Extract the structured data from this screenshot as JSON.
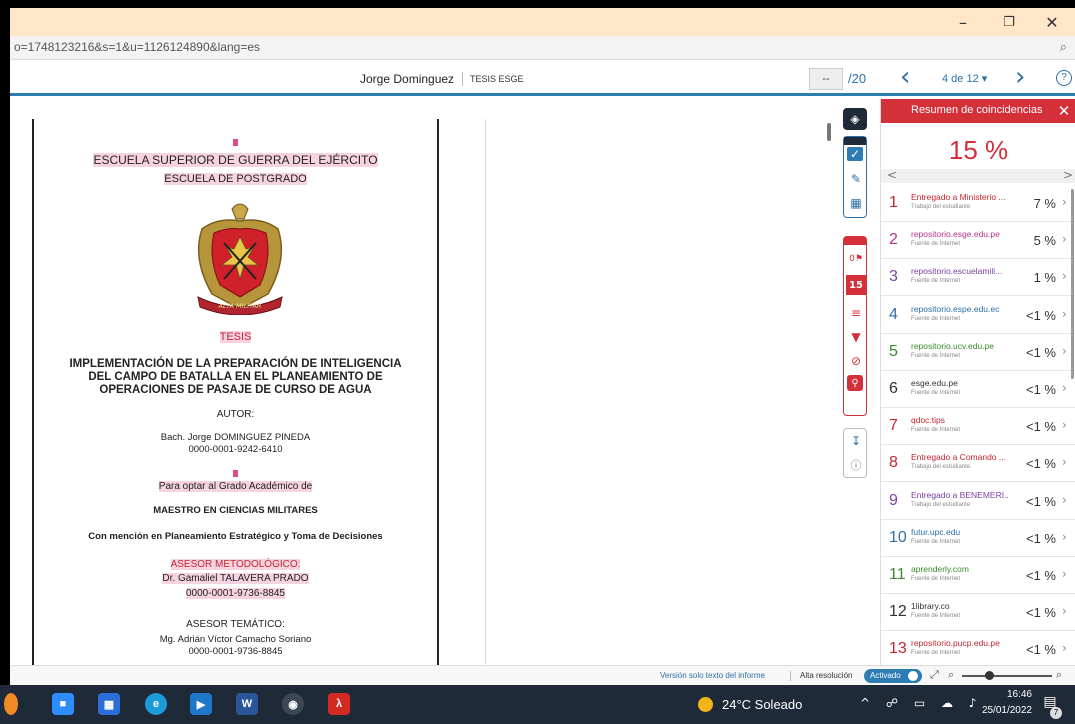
{
  "window": {
    "minimize": "–",
    "restore": "❐",
    "close": "✕"
  },
  "url": {
    "text": "o=1748123216&s=1&u=1126124890&lang=es",
    "zoom_icon": "zoom-icon"
  },
  "header": {
    "author": "Jorge Dominguez",
    "course": "TESIS ESGE",
    "page_input": "--",
    "page_total": "/20",
    "prev_icon": "‹",
    "next_icon": "›",
    "match_nav": "4 de 12 ▾",
    "help": "?"
  },
  "document": {
    "school": "ESCUELA SUPERIOR DE GUERRA DEL EJÉRCITO",
    "postgrad": "ESCUELA DE POSTGRADO",
    "crest_motto": "ALTA MILITAR",
    "thesis_label": "TESIS",
    "title_line1": "IMPLEMENTACIÓN DE LA PREPARACIÓN DE INTELIGENCIA",
    "title_line2": "DEL CAMPO DE BATALLA EN EL PLANEAMIENTO DE",
    "title_line3": "OPERACIONES DE PASAJE DE CURSO DE AGUA",
    "author_label": "AUTOR:",
    "author_name": "Bach. Jorge DOMINGUEZ PINEDA",
    "author_orcid": "0000-0001-9242-6410",
    "degree_intro": "Para optar al Grado Académico de",
    "degree": "MAESTRO EN CIENCIAS MILITARES",
    "mention": "Con mención en Planeamiento Estratégico y Toma de Decisiones",
    "method_advisor_label": "ASESOR METODOLÓGICO:",
    "method_advisor_name": "Dr. Gamaliel TALAVERA PRADO",
    "method_advisor_orcid": "0000-0001-9736-8845",
    "thematic_advisor_label": "ASESOR TEMÁTICO:",
    "thematic_advisor_name": "Mg. Adrián Víctor Camacho Soriano",
    "thematic_advisor_orcid": "0000-0001-9736-8845"
  },
  "toolbar": {
    "layers_icon": "layers-icon",
    "match_count": "15",
    "flag_count": "0"
  },
  "panel": {
    "title": "Resumen de coincidencias",
    "close": "✕",
    "percent": "15 %",
    "left_arrow": "<",
    "right_arrow": ">",
    "matches": [
      {
        "num": "1",
        "source": "Entregado a Ministerio ...",
        "type": "Trabajo del estudiante",
        "pct": "7 %",
        "color": "#c42630"
      },
      {
        "num": "2",
        "source": "repositorio.esge.edu.pe",
        "type": "Fuente de Internet",
        "pct": "5 %",
        "color": "#b5338a"
      },
      {
        "num": "3",
        "source": "repositorio.escuelamili...",
        "type": "Fuente de Internet",
        "pct": "1 %",
        "color": "#7a3fa0"
      },
      {
        "num": "4",
        "source": "repositorio.espe.edu.ec",
        "type": "Fuente de Internet",
        "pct": "<1 %",
        "color": "#2d6fa8"
      },
      {
        "num": "5",
        "source": "repositorio.ucv.edu.pe",
        "type": "Fuente de Internet",
        "pct": "<1 %",
        "color": "#3a8a2e"
      },
      {
        "num": "6",
        "source": "esge.edu.pe",
        "type": "Fuente de Internet",
        "pct": "<1 %",
        "color": "#333333"
      },
      {
        "num": "7",
        "source": "qdoc.tips",
        "type": "Fuente de Internet",
        "pct": "<1 %",
        "color": "#c42630"
      },
      {
        "num": "8",
        "source": "Entregado a Comando ...",
        "type": "Trabajo del estudiante",
        "pct": "<1 %",
        "color": "#c42630"
      },
      {
        "num": "9",
        "source": "Entregado a BENEMERI...",
        "type": "Trabajo del estudiante",
        "pct": "<1 %",
        "color": "#7a3fa0"
      },
      {
        "num": "10",
        "source": "futur.upc.edu",
        "type": "Fuente de Internet",
        "pct": "<1 %",
        "color": "#2d6fa8"
      },
      {
        "num": "11",
        "source": "aprenderly.com",
        "type": "Fuente de Internet",
        "pct": "<1 %",
        "color": "#3a8a2e"
      },
      {
        "num": "12",
        "source": "1library.co",
        "type": "Fuente de Internet",
        "pct": "<1 %",
        "color": "#333333"
      },
      {
        "num": "13",
        "source": "repositorio.pucp.edu.pe",
        "type": "Fuente de Internet",
        "pct": "<1 %",
        "color": "#c42630"
      }
    ]
  },
  "footer": {
    "text_only": "Versión solo texto del informe",
    "hires_label": "Alta resolución",
    "hires_state": "Activado"
  },
  "taskbar": {
    "weather": "24°C  Soleado",
    "time": "16:46",
    "date": "25/01/2022",
    "notifications": "7"
  }
}
